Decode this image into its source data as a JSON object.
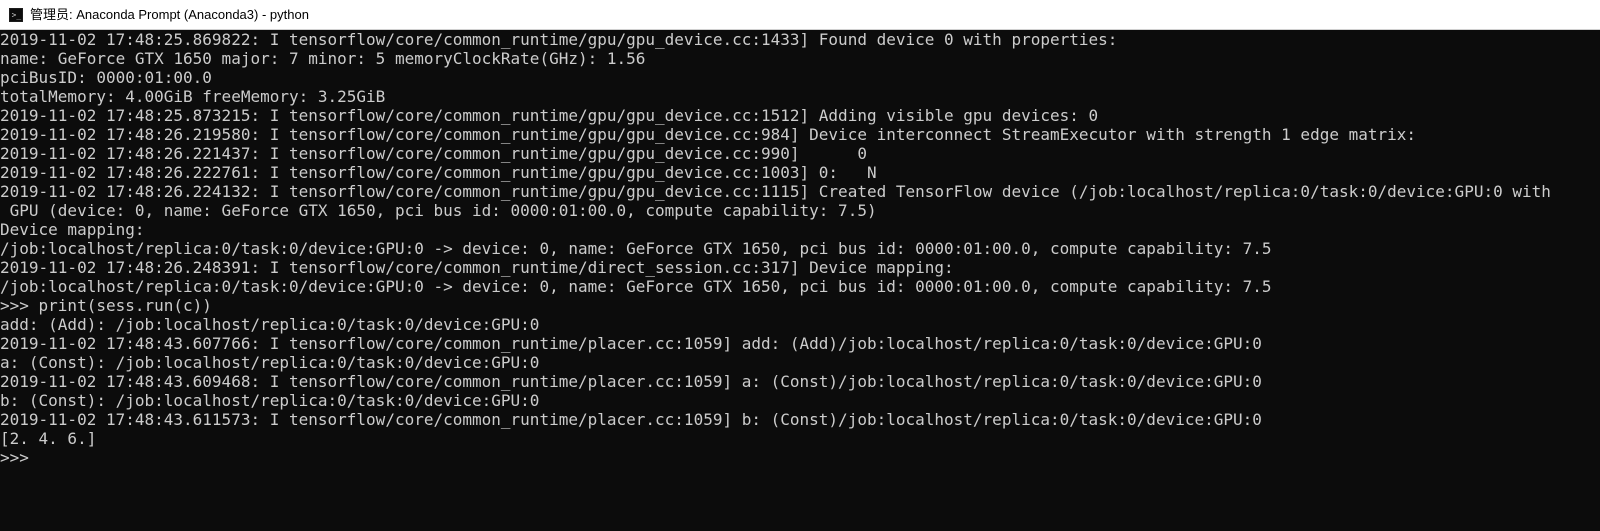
{
  "titlebar": {
    "text": "管理员: Anaconda Prompt (Anaconda3) - python"
  },
  "terminal": {
    "lines": [
      "2019-11-02 17:48:25.869822: I tensorflow/core/common_runtime/gpu/gpu_device.cc:1433] Found device 0 with properties:",
      "name: GeForce GTX 1650 major: 7 minor: 5 memoryClockRate(GHz): 1.56",
      "pciBusID: 0000:01:00.0",
      "totalMemory: 4.00GiB freeMemory: 3.25GiB",
      "2019-11-02 17:48:25.873215: I tensorflow/core/common_runtime/gpu/gpu_device.cc:1512] Adding visible gpu devices: 0",
      "2019-11-02 17:48:26.219580: I tensorflow/core/common_runtime/gpu/gpu_device.cc:984] Device interconnect StreamExecutor with strength 1 edge matrix:",
      "2019-11-02 17:48:26.221437: I tensorflow/core/common_runtime/gpu/gpu_device.cc:990]      0",
      "2019-11-02 17:48:26.222761: I tensorflow/core/common_runtime/gpu/gpu_device.cc:1003] 0:   N",
      "2019-11-02 17:48:26.224132: I tensorflow/core/common_runtime/gpu/gpu_device.cc:1115] Created TensorFlow device (/job:localhost/replica:0/task:0/device:GPU:0 with",
      " GPU (device: 0, name: GeForce GTX 1650, pci bus id: 0000:01:00.0, compute capability: 7.5)",
      "Device mapping:",
      "/job:localhost/replica:0/task:0/device:GPU:0 -> device: 0, name: GeForce GTX 1650, pci bus id: 0000:01:00.0, compute capability: 7.5",
      "2019-11-02 17:48:26.248391: I tensorflow/core/common_runtime/direct_session.cc:317] Device mapping:",
      "/job:localhost/replica:0/task:0/device:GPU:0 -> device: 0, name: GeForce GTX 1650, pci bus id: 0000:01:00.0, compute capability: 7.5",
      "",
      ">>> print(sess.run(c))",
      "add: (Add): /job:localhost/replica:0/task:0/device:GPU:0",
      "2019-11-02 17:48:43.607766: I tensorflow/core/common_runtime/placer.cc:1059] add: (Add)/job:localhost/replica:0/task:0/device:GPU:0",
      "a: (Const): /job:localhost/replica:0/task:0/device:GPU:0",
      "2019-11-02 17:48:43.609468: I tensorflow/core/common_runtime/placer.cc:1059] a: (Const)/job:localhost/replica:0/task:0/device:GPU:0",
      "b: (Const): /job:localhost/replica:0/task:0/device:GPU:0",
      "2019-11-02 17:48:43.611573: I tensorflow/core/common_runtime/placer.cc:1059] b: (Const)/job:localhost/replica:0/task:0/device:GPU:0",
      "[2. 4. 6.]",
      ">>>"
    ]
  }
}
